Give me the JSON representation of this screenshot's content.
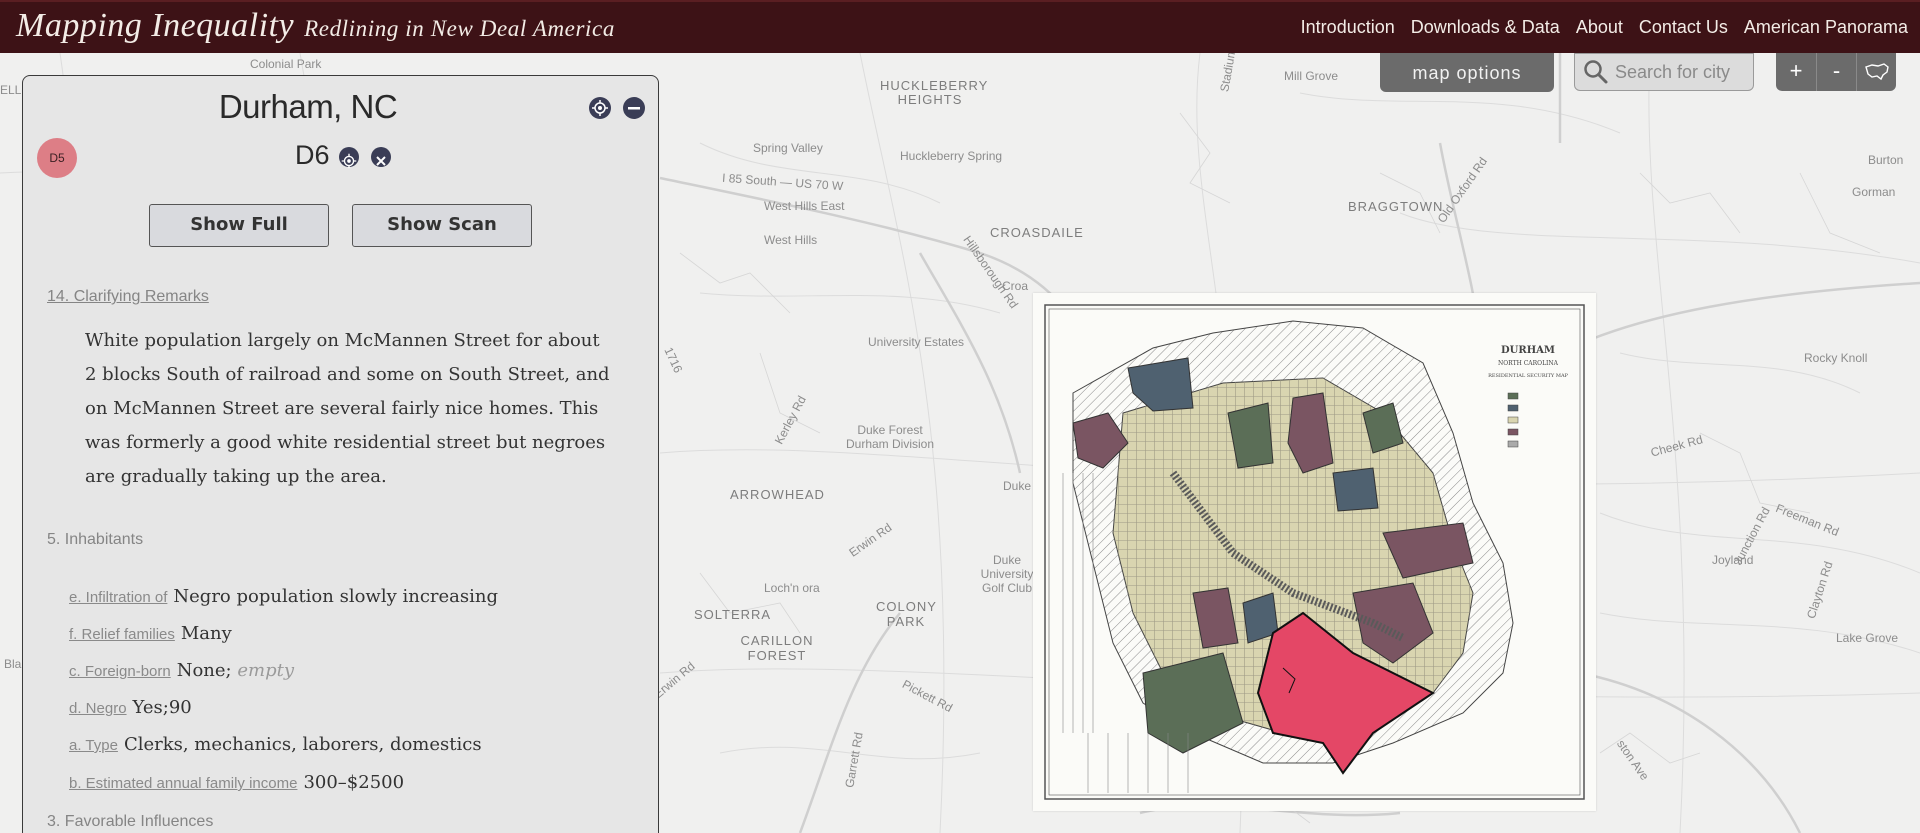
{
  "header": {
    "title": "Mapping Inequality",
    "subtitle": "Redlining in New Deal America",
    "nav": [
      "Introduction",
      "Downloads & Data",
      "About",
      "Contact Us",
      "American Panorama"
    ]
  },
  "controls": {
    "map_options_label": "map options",
    "search_placeholder": "Search for city",
    "zoom_in": "+",
    "zoom_out": "-"
  },
  "panel": {
    "city": "Durham, NC",
    "badge": "D5",
    "neighborhood": "D6",
    "show_full": "Show Full",
    "show_scan": "Show Scan",
    "remarks_heading": "14. Clarifying Remarks",
    "remarks_text": "White population largely on McMannen Street for about 2 blocks South of railroad and some on South Street, and on McMannen Street are several fairly nice homes. This was formerly a good white residential street but negroes are gradually taking up the area.",
    "inhabitants_heading": "5. Inhabitants",
    "fields": [
      {
        "label": "e. Infiltration of",
        "value": "Negro population slowly increasing"
      },
      {
        "label": "f. Relief families",
        "value": "Many"
      },
      {
        "label": "c. Foreign-born",
        "value": "None;",
        "extra": "empty"
      },
      {
        "label": "d. Negro",
        "value": "Yes;90"
      },
      {
        "label": "a. Type",
        "value": "Clerks, mechanics, laborers, domestics"
      },
      {
        "label": "b. Estimated annual family income",
        "value": "300–$2500"
      }
    ],
    "favorable_heading": "3. Favorable Influences"
  },
  "map_labels": {
    "colonial_park": "Colonial Park",
    "huckleberry_heights": "HUCKLEBERRY HEIGHTS",
    "huckleberry_spring": "Huckleberry Spring",
    "spring_valley": "Spring Valley",
    "mill_grove": "Mill Grove",
    "burton": "Burton",
    "gorman": "Gorman",
    "braggtown": "BRAGGTOWN",
    "old_oxford_rd": "Old Oxford Rd",
    "i85": "I 85 South — US 70 W",
    "west_hills_east": "West Hills East",
    "west_hills": "West Hills",
    "croasdaile": "CROASDAILE",
    "hillsborough_rd": "Hillsborough Rd",
    "croa": "Croa",
    "university_estates": "University Estates",
    "kerley_rd": "Kerley Rd",
    "duke_forest": "Duke Forest Durham Division",
    "arrowhead": "ARROWHEAD",
    "duke": "Duke",
    "erwin_rd": "Erwin Rd",
    "duke_golf": "Duke University Golf Club",
    "lochn_ora": "Loch'n ora",
    "colony_park": "COLONY PARK",
    "solterra": "SOLTERRA",
    "carillon_forest": "CARILLON FOREST",
    "pickett_rd": "Pickett Rd",
    "garrett_rd": "Garrett Rd",
    "cheek_rd": "Cheek Rd",
    "rocky_knoll": "Rocky Knoll",
    "junction_rd": "Junction Rd",
    "freeman_rd": "Freeman Rd",
    "joyland": "Joyland",
    "clayton_rd": "Clayton Rd",
    "lake_grove": "Lake Grove",
    "ston_ave": "ston Ave",
    "r1716": "1716",
    "ellis": "ELLIS",
    "bla": "Bla",
    "stadium": "Stadium"
  },
  "scan": {
    "title": "DURHAM",
    "subtitle": "NORTH CAROLINA",
    "caption": "RESIDENTIAL SECURITY MAP",
    "colors": {
      "A": "#5b6e57",
      "B": "#4f6170",
      "C": "#d9d5b0",
      "D": "#e44766",
      "D_other": "#7a5562"
    }
  }
}
